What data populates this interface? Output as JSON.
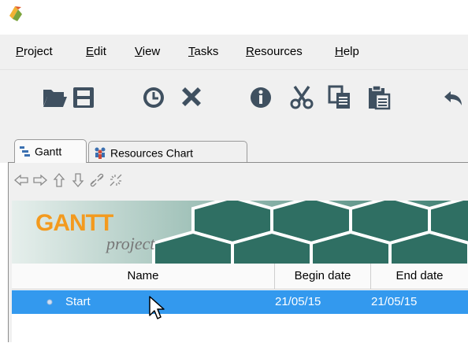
{
  "menu": {
    "items": [
      {
        "accel": "P",
        "rest": "roject"
      },
      {
        "accel": "E",
        "rest": "dit"
      },
      {
        "accel": "V",
        "rest": "iew"
      },
      {
        "accel": "T",
        "rest": "asks"
      },
      {
        "accel": "R",
        "rest": "esources"
      },
      {
        "accel": "H",
        "rest": "elp"
      }
    ]
  },
  "tabs": {
    "gantt": "Gantt",
    "resources": "Resources Chart"
  },
  "banner": {
    "logo_main": "GANTT",
    "logo_sub": "project"
  },
  "table": {
    "columns": [
      "Name",
      "Begin date",
      "End date"
    ],
    "rows": [
      {
        "name": "Start",
        "begin": "21/05/15",
        "end": "21/05/15",
        "selected": true
      }
    ]
  },
  "icons": {
    "toolbar": [
      "open-folder-icon",
      "save-icon",
      "history-clock-icon",
      "delete-x-icon",
      "info-icon",
      "cut-scissors-icon",
      "copy-icon",
      "paste-icon",
      "undo-icon"
    ],
    "nav": [
      "arrow-left-icon",
      "arrow-right-icon",
      "arrow-up-icon",
      "arrow-down-icon",
      "link-icon",
      "unlink-icon"
    ]
  },
  "colors": {
    "selection": "#3399ee",
    "toolbar_icon": "#3f5060",
    "logo_orange": "#f39a1e",
    "banner_bg": "#c5dbd6"
  }
}
